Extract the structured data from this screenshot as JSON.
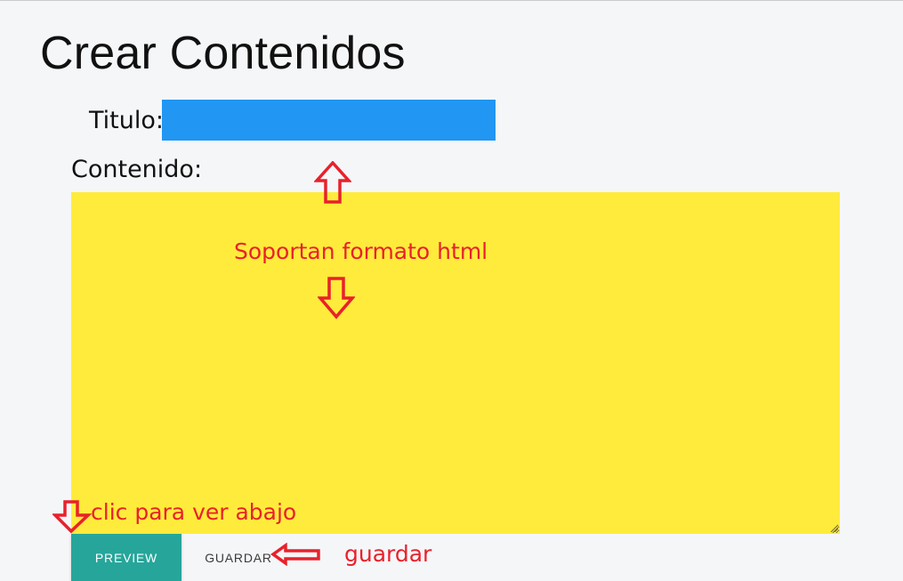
{
  "page": {
    "title": "Crear Contenidos"
  },
  "form": {
    "titulo_label": "Titulo:",
    "titulo_value": "",
    "contenido_label": "Contenido:",
    "contenido_value": "",
    "preview_label": "PREVIEW",
    "guardar_label": "GUARDAR"
  },
  "annotations": {
    "html_support": "Soportan formato html",
    "preview_hint": "clic para ver abajo",
    "guardar_hint": "guardar",
    "color": "#e8212b"
  },
  "colors": {
    "titulo_input_bg": "#2196f3",
    "contenido_bg": "#ffeb3b",
    "preview_button_bg": "#26a69a",
    "page_bg": "#f5f6f8"
  },
  "icons": {
    "up_arrow": "up-arrow-icon",
    "down_arrow": "down-arrow-icon",
    "left_arrow": "left-arrow-icon",
    "resize_grip": "resize-grip-icon"
  }
}
